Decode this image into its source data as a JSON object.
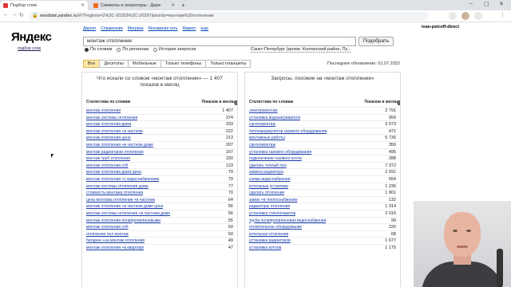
{
  "browser": {
    "tabs": [
      {
        "label": "Подбор слов",
        "favicon_color": "#e2383f"
      },
      {
        "label": "Символы и операторы - Дире",
        "favicon_color": "#f36b1c"
      }
    ],
    "url_host": "wordstat.yandex.ru",
    "url_path": "/#!/?regions=2%2C-20293%2C-20297&words=монтаж%20отопление"
  },
  "page": {
    "logo": "Яндекс",
    "logo_sub": "подбор слов",
    "topnav": [
      "Директ",
      "Справочник",
      "Метрика",
      "Рекламная сеть",
      "Маркет",
      "еще"
    ],
    "user": "ivan-petroff-direct",
    "search": {
      "value": "монтаж отопление",
      "button": "Подобрать",
      "modes": [
        {
          "label": "По словам",
          "checked": true
        },
        {
          "label": "По регионам",
          "checked": false
        },
        {
          "label": "История запросов",
          "checked": false
        }
      ],
      "region": "Санкт-Петербург (кроме: Колпинский район, Пу..."
    },
    "device_tabs": [
      "Все",
      "Десктопы",
      "Мобильные",
      "Только телефоны",
      "Только планшеты"
    ],
    "updated": "Последнее обновление: 01.07.2022"
  },
  "left_panel": {
    "title": "Что искали со словом «монтаж отопление» — 1 407 показов в месяц",
    "col_keyword": "Статистика по словам",
    "col_count": "Показов в месяц",
    "rows": [
      {
        "kw": "монтаж отопления",
        "count": "1 407"
      },
      {
        "kw": "монтаж системы отопления",
        "count": "374"
      },
      {
        "kw": "монтаж отопления дома",
        "count": "333"
      },
      {
        "kw": "монтаж отопления +в частном",
        "count": "222"
      },
      {
        "kw": "монтаж отопления цена",
        "count": "213"
      },
      {
        "kw": "монтаж отопления +в частном доме",
        "count": "207"
      },
      {
        "kw": "монтаж радиаторов отопления",
        "count": "167"
      },
      {
        "kw": "монтаж труб отопления",
        "count": "150"
      },
      {
        "kw": "монтаж отопления спб",
        "count": "123"
      },
      {
        "kw": "монтаж отопления дома цена",
        "count": "79"
      },
      {
        "kw": "монтаж отопления +с водоснабжением",
        "count": "79"
      },
      {
        "kw": "монтаж системы отопления дома",
        "count": "77"
      },
      {
        "kw": "стоимость монтажа отопления",
        "count": "70"
      },
      {
        "kw": "цена монтажа отопления +в частном",
        "count": "64"
      },
      {
        "kw": "монтаж отопления +в частном доме цена",
        "count": "56"
      },
      {
        "kw": "монтаж системы отопления +в частном доме",
        "count": "56"
      },
      {
        "kw": "монтаж отопления полипропиленовыми",
        "count": "55"
      },
      {
        "kw": "монтаж отопления спб",
        "count": "50"
      },
      {
        "kw": "отопление пол монтаж",
        "count": "50"
      },
      {
        "kw": "батареи +на монтаж отопления",
        "count": "49"
      },
      {
        "kw": "монтаж отопления +в квартире",
        "count": "47"
      }
    ]
  },
  "right_panel": {
    "title": "Запросы, похожие на «монтаж отопление»",
    "col_keyword": "Статистика по словам",
    "col_count": "Показов в месяц",
    "rows": [
      {
        "kw": "электромонтаж",
        "count": "2 791"
      },
      {
        "kw": "установка водонагревателя",
        "count": "959"
      },
      {
        "kw": "сантехмонтаж",
        "count": "3 973"
      },
      {
        "kw": "теплоаккумулятор газового оборудования",
        "count": "471"
      },
      {
        "kw": "монтажные работы",
        "count": "5 736"
      },
      {
        "kw": "сантехмонтаж",
        "count": "359"
      },
      {
        "kw": "установка газового оборудования",
        "count": "495"
      },
      {
        "kw": "подключение газового котла",
        "count": "288"
      },
      {
        "kw": "сделать теплый пол",
        "count": "7 372"
      },
      {
        "kw": "замена радиатора",
        "count": "2 591"
      },
      {
        "kw": "схема водоснабжения",
        "count": "654"
      },
      {
        "kw": "котельные установки",
        "count": "1 236"
      },
      {
        "kw": "сделать отопление",
        "count": "1 801"
      },
      {
        "kw": "замок +в теплоснабжение",
        "count": "132"
      },
      {
        "kw": "радиаторы отопления",
        "count": "1 314"
      },
      {
        "kw": "установка стеклопакетов",
        "count": "2 015"
      },
      {
        "kw": "труба полипропиленовая водоснабжения",
        "count": "99"
      },
      {
        "kw": "отопительное оборудование",
        "count": "220"
      },
      {
        "kw": "котельная отопления",
        "count": "68"
      },
      {
        "kw": "установка радиаторов",
        "count": "1 677"
      },
      {
        "kw": "установка котлов",
        "count": "1 175"
      }
    ]
  }
}
